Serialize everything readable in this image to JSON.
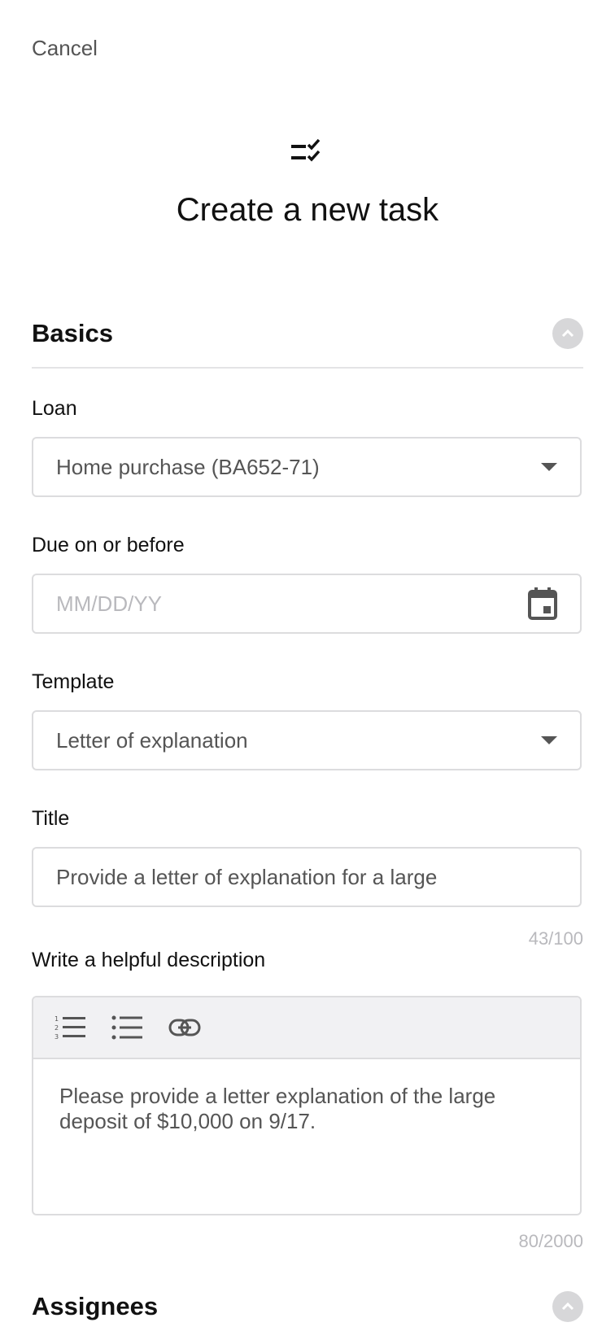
{
  "header": {
    "cancel_label": "Cancel",
    "title": "Create a new task",
    "title_icon": "checklist-icon"
  },
  "basics": {
    "title": "Basics",
    "loan": {
      "label": "Loan",
      "value": "Home purchase (BA652-71)"
    },
    "due": {
      "label": "Due on or before",
      "placeholder": "MM/DD/YY"
    },
    "template": {
      "label": "Template",
      "value": "Letter of explanation"
    },
    "task_title": {
      "label": "Title",
      "value": "Provide a letter of explanation for a large",
      "counter": "43/100"
    },
    "description": {
      "label": "Write a helpful description",
      "toolbar": [
        "numbered-list-icon",
        "bulleted-list-icon",
        "link-icon"
      ],
      "value": "Please provide a letter explanation of the large deposit of $10,000 on 9/17.",
      "counter": "80/2000"
    }
  },
  "assignees": {
    "title": "Assignees"
  },
  "colors": {
    "border": "#dcdcde",
    "muted": "#b9b9bd",
    "text": "#555555",
    "toggle_bg": "#d7d7d9"
  }
}
